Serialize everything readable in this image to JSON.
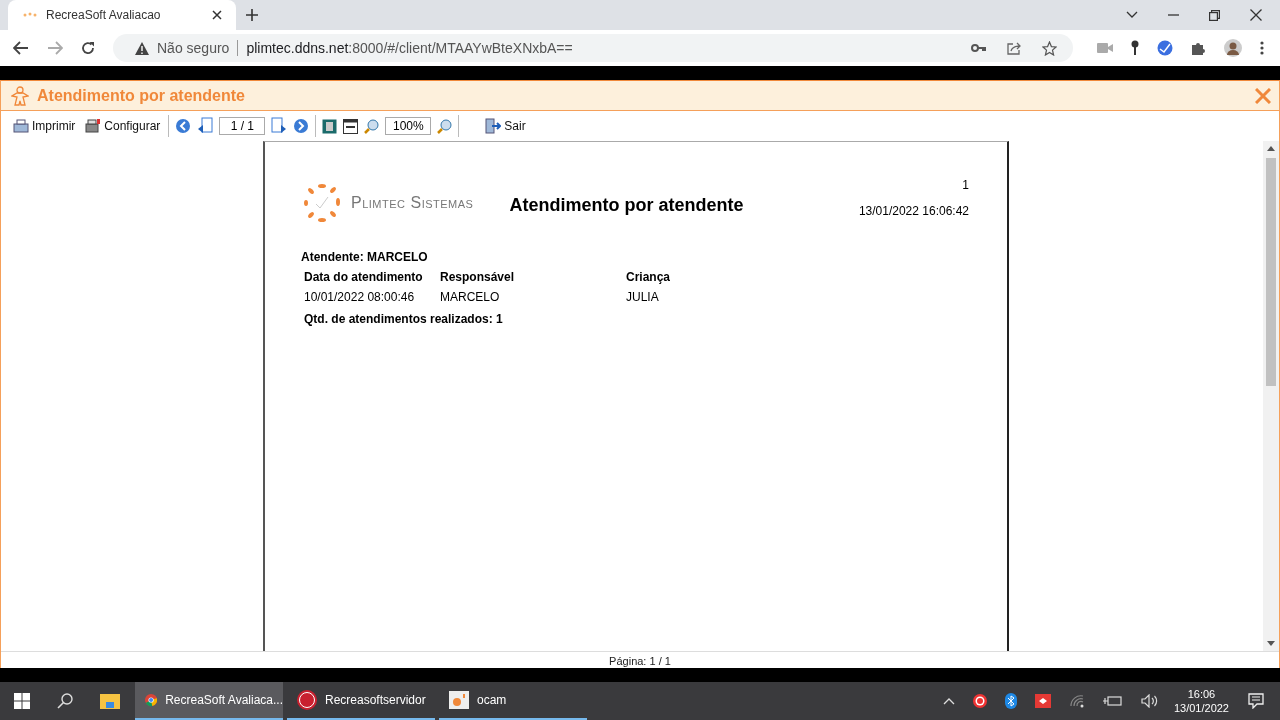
{
  "browser": {
    "tab_title": "RecreaSoft Avaliacao",
    "security": "Não seguro",
    "url_host": "plimtec.ddns.net",
    "url_rest": ":8000/#/client/MTAAYwBteXNxbA=="
  },
  "app": {
    "title": "Atendimento por atendente"
  },
  "toolbar": {
    "print": "Imprimir",
    "configure": "Configurar",
    "page_field": "1 / 1",
    "zoom_field": "100%",
    "exit": "Sair"
  },
  "report": {
    "page_number": "1",
    "datetime": "13/01/2022 16:06:42",
    "logo_text": "Plimtec Sistemas",
    "title": "Atendimento por atendente",
    "attendant": "Atendente: MARCELO",
    "columns": [
      "Data do atendimento",
      "Responsável",
      "Criança"
    ],
    "rows": [
      [
        "10/01/2022 08:00:46",
        "MARCELO",
        "JULIA"
      ]
    ],
    "summary": "Qtd. de atendimentos realizados: 1"
  },
  "footer": "Página: 1 / 1",
  "taskbar": {
    "items": [
      {
        "label": "RecreaSoft Avaliaca...",
        "kind": "chrome",
        "selected": true
      },
      {
        "label": "Recreasoftservidor",
        "kind": "dx",
        "selected": false
      },
      {
        "label": "ocam",
        "kind": "ocam",
        "selected": false
      }
    ],
    "time": "16:06",
    "date": "13/01/2022"
  }
}
